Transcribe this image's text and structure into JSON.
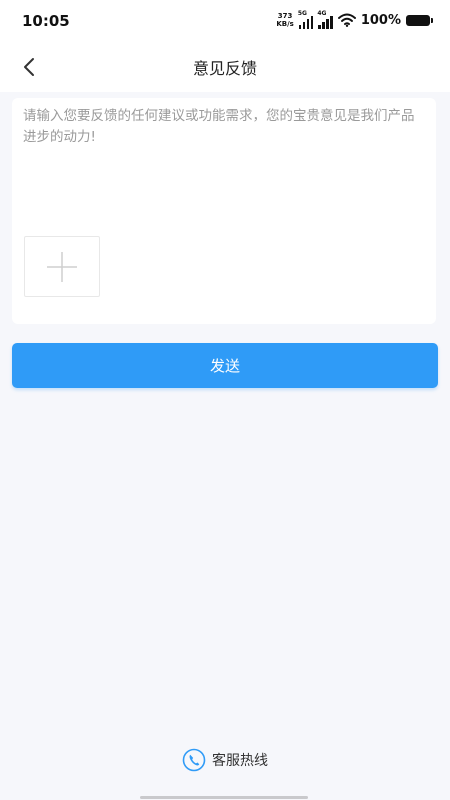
{
  "status_bar": {
    "time": "10:05",
    "net_speed_value": "373",
    "net_speed_unit": "KB/s",
    "signal1_label": "5G",
    "signal2_label": "4G",
    "battery": "100%"
  },
  "header": {
    "title": "意见反馈"
  },
  "feedback": {
    "placeholder": "请输入您要反馈的任何建议或功能需求，您的宝贵意见是我们产品进步的动力!",
    "value": ""
  },
  "send_button": {
    "label": "发送"
  },
  "hotline": {
    "label": "客服热线"
  },
  "colors": {
    "accent": "#2f9bf7",
    "background": "#f6f7fb",
    "card": "#ffffff"
  },
  "icons": {
    "back": "chevron-left-icon",
    "add_image": "plus-icon",
    "hotline": "phone-icon",
    "wifi": "wifi-icon",
    "battery": "battery-icon"
  }
}
